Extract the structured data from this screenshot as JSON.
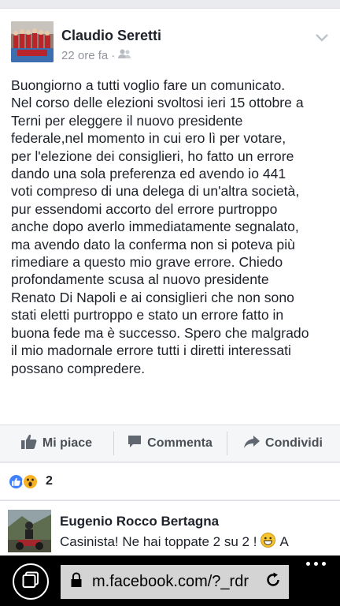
{
  "post": {
    "author": "Claudio Seretti",
    "time": "22 ore fa",
    "separator": "·",
    "body": "Buongiorno a tutti voglio fare un comunicato.\nNel corso delle elezioni svoltosi ieri 15 ottobre a\nTerni per eleggere il nuovo presidente\nfederale,nel momento in cui ero lì per votare,\nper l'elezione dei consiglieri, ho fatto un errore\ndando una sola preferenza ed avendo io 441\nvoti compreso di una delega di un'altra società,\npur essendomi accorto del errore purtroppo\nanche dopo averlo immediatamente segnalato,\nma avendo dato la conferma non si poteva più\nrimediare a questo mio grave errore. Chiedo\nprofondamente scusa al nuovo presidente\nRenato Di Napoli e ai consiglieri che non sono\nstati eletti purtroppo e stato un errore fatto in\nbuona fede ma è successo. Spero che malgrado\nil mio madornale errore tutti i diretti interessati\npossano compredere."
  },
  "actions": {
    "like": "Mi piace",
    "comment": "Commenta",
    "share": "Condividi"
  },
  "reactions": {
    "count": "2",
    "types": [
      "like-icon",
      "wow-icon"
    ]
  },
  "comment": {
    "author": "Eugenio Rocco Bertagna",
    "text": "Casinista! Ne hai toppate 2 su 2 !",
    "trailing": "A"
  },
  "browser": {
    "url": "m.facebook.com/?_rdr"
  },
  "colors": {
    "link_blue": "#4080ff",
    "wow_yellow": "#f7b125",
    "meta_gray": "#90949c"
  }
}
